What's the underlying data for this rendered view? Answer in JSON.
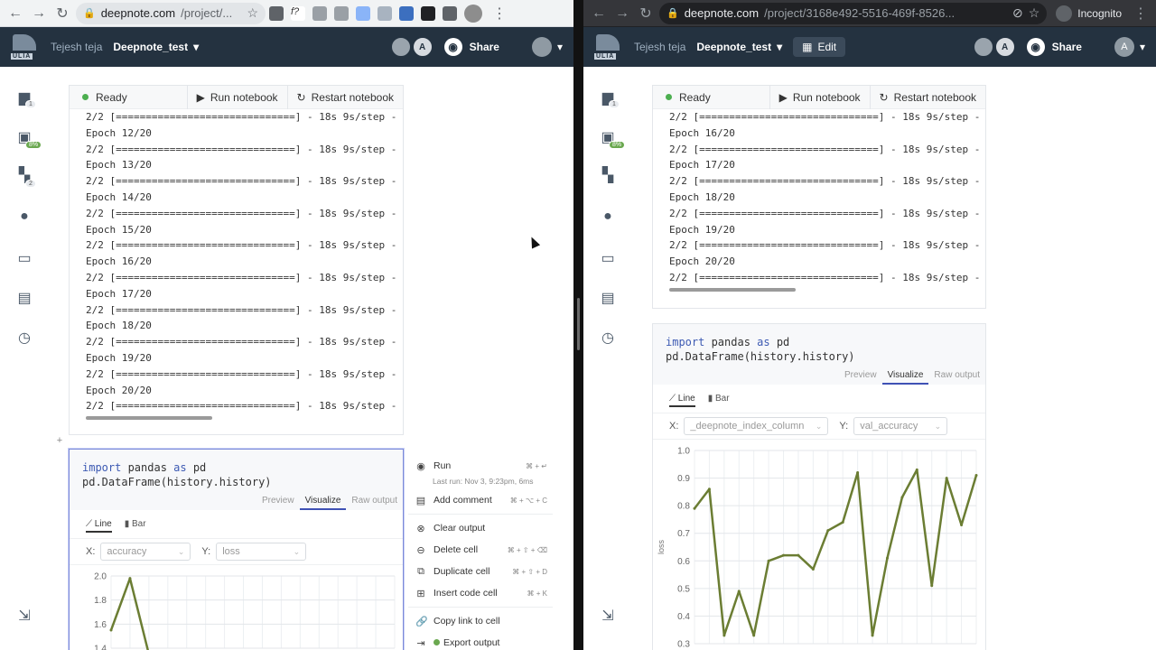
{
  "left": {
    "browser": {
      "url_domain": "deepnote.com",
      "url_path": "/project/...",
      "incognito": false
    },
    "header": {
      "workspace": "Tejesh teja",
      "project": "Deepnote_test",
      "share_label": "Share",
      "avatar_letter": "A"
    },
    "sidebar_badges": {
      "files": "1",
      "env": "8%",
      "integrations": "2"
    },
    "runbar": {
      "status": "Ready",
      "run": "Run notebook",
      "restart": "Restart notebook"
    },
    "output_lines": [
      "2/2 [==============================] - 18s 9s/step -",
      "Epoch 12/20",
      "2/2 [==============================] - 18s 9s/step -",
      "Epoch 13/20",
      "2/2 [==============================] - 18s 9s/step -",
      "Epoch 14/20",
      "2/2 [==============================] - 18s 9s/step -",
      "Epoch 15/20",
      "2/2 [==============================] - 18s 9s/step -",
      "Epoch 16/20",
      "2/2 [==============================] - 18s 9s/step -",
      "Epoch 17/20",
      "2/2 [==============================] - 18s 9s/step -",
      "Epoch 18/20",
      "2/2 [==============================] - 18s 9s/step -",
      "Epoch 19/20",
      "2/2 [==============================] - 18s 9s/step -",
      "Epoch 20/20",
      "2/2 [==============================] - 18s 9s/step -"
    ],
    "code": {
      "line1_kw": "import",
      "line1_rest": " pandas ",
      "line1_kw2": "as",
      "line1_end": " pd",
      "line2": "pd.DataFrame(history.history)"
    },
    "vis_tabs": [
      "Preview",
      "Visualize",
      "Raw output"
    ],
    "chart_tabs": [
      "Line",
      "Bar"
    ],
    "x_label": "X:",
    "x_value": "accuracy",
    "y_label": "Y:",
    "y_value": "loss",
    "context_menu": {
      "run": "Run",
      "run_kb": "⌘ + ↵",
      "last_run": "Last run: Nov 3, 9:23pm, 6ms",
      "comment": "Add comment",
      "comment_kb": "⌘ + ⌥ + C",
      "clear": "Clear output",
      "delete": "Delete cell",
      "delete_kb": "⌘ + ⇧ + ⌫",
      "duplicate": "Duplicate cell",
      "duplicate_kb": "⌘ + ⇧ + D",
      "insert": "Insert code cell",
      "insert_kb": "⌘ + K",
      "copy_link": "Copy link to cell",
      "export": "Export output"
    }
  },
  "right": {
    "browser": {
      "url_domain": "deepnote.com",
      "url_path": "/project/3168e492-5516-469f-8526...",
      "incognito_label": "Incognito"
    },
    "header": {
      "workspace": "Tejesh teja",
      "project": "Deepnote_test",
      "edit_label": "Edit",
      "share_label": "Share",
      "avatar_letter": "A"
    },
    "runbar": {
      "status": "Ready",
      "run": "Run notebook",
      "restart": "Restart notebook"
    },
    "output_lines": [
      "2/2 [==============================] - 18s 9s/step -",
      "Epoch 16/20",
      "2/2 [==============================] - 18s 9s/step -",
      "Epoch 17/20",
      "2/2 [==============================] - 18s 9s/step -",
      "Epoch 18/20",
      "2/2 [==============================] - 18s 9s/step -",
      "Epoch 19/20",
      "2/2 [==============================] - 18s 9s/step -",
      "Epoch 20/20",
      "2/2 [==============================] - 18s 9s/step -"
    ],
    "code": {
      "line1_kw": "import",
      "line1_rest": " pandas ",
      "line1_kw2": "as",
      "line1_end": " pd",
      "line2": "pd.DataFrame(history.history)"
    },
    "vis_tabs": [
      "Preview",
      "Visualize",
      "Raw output"
    ],
    "chart_tabs": [
      "Line",
      "Bar"
    ],
    "x_label": "X:",
    "x_value": "_deepnote_index_column",
    "y_label": "Y:",
    "y_value": "val_accuracy"
  },
  "chart_data": [
    {
      "type": "line",
      "panel": "left",
      "ylabel": "",
      "ylim": [
        1.4,
        2.0
      ],
      "yticks": [
        2.0,
        1.8,
        1.6,
        1.4
      ],
      "x": [
        0,
        1,
        2
      ],
      "values": [
        1.55,
        1.98,
        1.35
      ],
      "color": "#6b7d33"
    },
    {
      "type": "line",
      "panel": "right",
      "ylabel": "loss",
      "ylim": [
        0.3,
        1.0
      ],
      "yticks": [
        1.0,
        0.9,
        0.8,
        0.7,
        0.6,
        0.5,
        0.4,
        0.3
      ],
      "x": [
        0,
        1,
        2,
        3,
        4,
        5,
        6,
        7,
        8,
        9,
        10,
        11,
        12,
        13,
        14,
        15,
        16,
        17,
        18,
        19
      ],
      "values": [
        0.79,
        0.86,
        0.33,
        0.49,
        0.33,
        0.6,
        0.62,
        0.62,
        0.57,
        0.71,
        0.74,
        0.92,
        0.33,
        0.61,
        0.83,
        0.93,
        0.51,
        0.9,
        0.73,
        0.91
      ],
      "color": "#6b7d33"
    }
  ]
}
